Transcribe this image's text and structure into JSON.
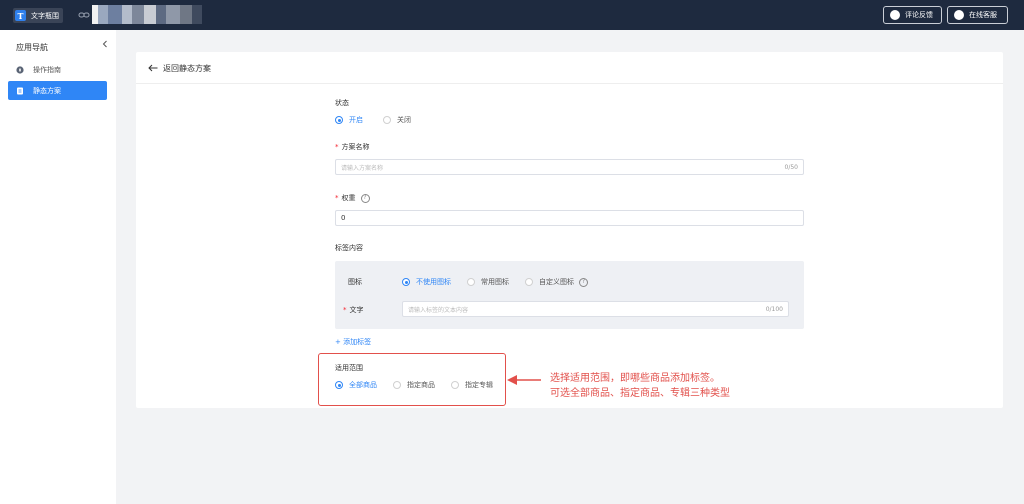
{
  "topbar": {
    "brand_logo_letter": "T",
    "brand_name": "文字瓶围",
    "buttons": {
      "feedback": "评论反馈",
      "service": "在线客服"
    }
  },
  "sidebar": {
    "title": "应用导航",
    "items": [
      {
        "label": "操作指南",
        "active": false
      },
      {
        "label": "静态方案",
        "active": true
      }
    ]
  },
  "main": {
    "back_label": "返回静态方案",
    "status": {
      "label": "状态",
      "options": [
        {
          "label": "开启",
          "selected": true
        },
        {
          "label": "关闭",
          "selected": false
        }
      ]
    },
    "plan_name": {
      "label": "方案名称",
      "placeholder": "请输入方案名称",
      "counter": "0/50"
    },
    "weight": {
      "label": "权重",
      "value": "0"
    },
    "tag_content": {
      "label": "标签内容",
      "icon_label": "图标",
      "icon_options": [
        {
          "label": "不使用图标",
          "selected": true
        },
        {
          "label": "常用图标",
          "selected": false
        },
        {
          "label": "自定义图标",
          "selected": false
        }
      ],
      "text_label": "文字",
      "text_placeholder": "请输入标签的文本内容",
      "text_counter": "0/100",
      "add_label": "+ 添加标签"
    },
    "scope": {
      "label": "适用范围",
      "options": [
        {
          "label": "全部商品",
          "selected": true
        },
        {
          "label": "指定商品",
          "selected": false
        },
        {
          "label": "指定专辑",
          "selected": false
        }
      ]
    }
  },
  "annotation": {
    "line1": "选择适用范围，即哪些商品添加标签。",
    "line2": "可选全部商品、指定商品、专辑三种类型",
    "color": "#e2504b"
  },
  "colors": {
    "topbar": "#1e2a3f",
    "accent": "#2f86f6",
    "page_bg": "#f2f3f5"
  }
}
